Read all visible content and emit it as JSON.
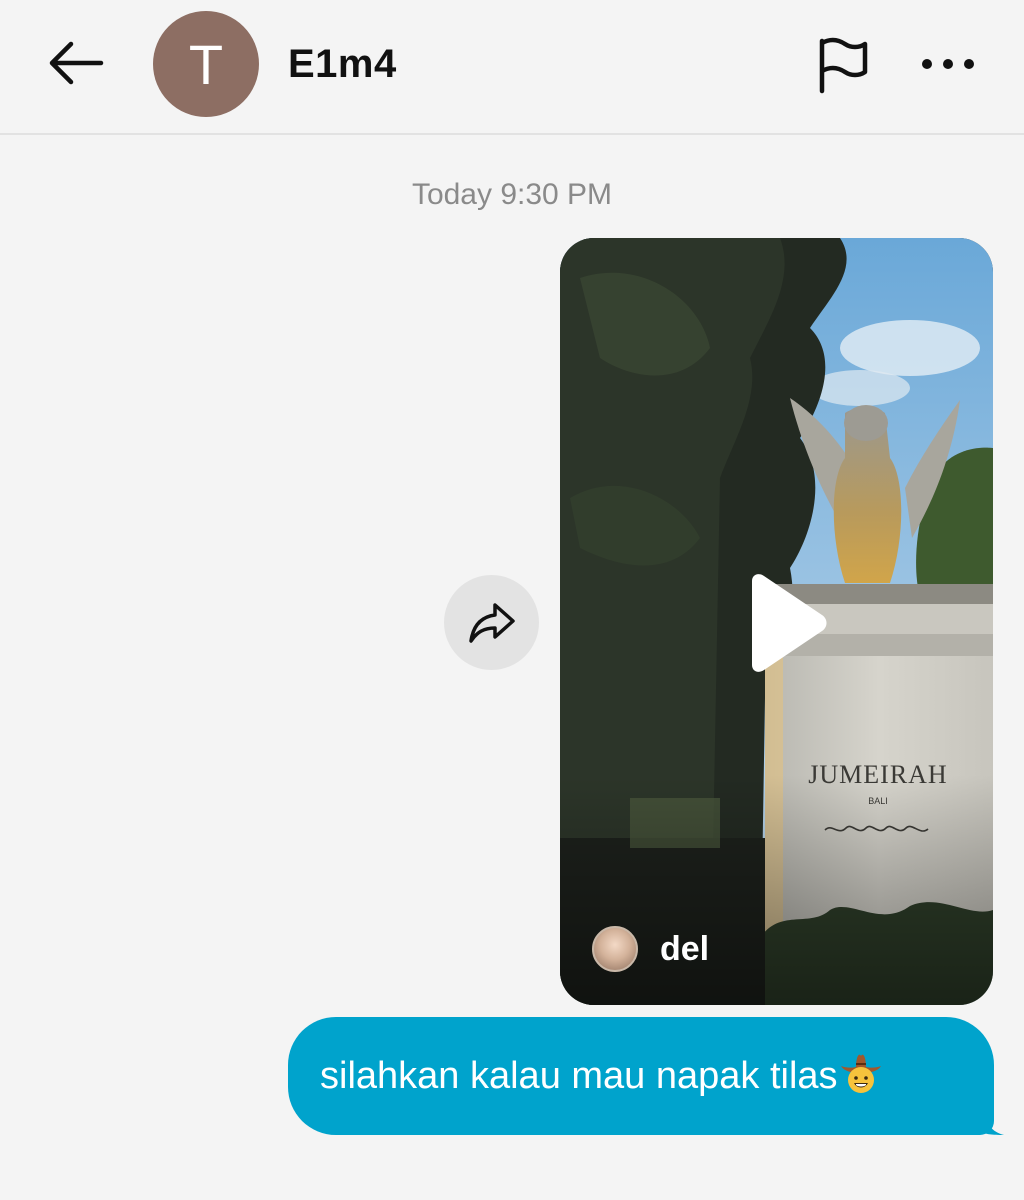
{
  "header": {
    "back_icon": "arrow-left-icon",
    "avatar_initial": "T",
    "avatar_color": "#8d6e63",
    "contact_name": "E1m4",
    "report_icon": "flag-icon",
    "more_icon": "more-horizontal-icon"
  },
  "conversation": {
    "timestamp": "Today 9:30 PM",
    "forward_icon": "share-arrow-icon",
    "shared_video": {
      "author": "del",
      "sign_brand": "JUMEIRAH",
      "sign_location": "BALI",
      "play_icon": "play-icon"
    },
    "message": {
      "text": "silahkan kalau mau napak tilas",
      "emoji": "cowboy-face-emoji",
      "bubble_color": "#00a3cc"
    }
  }
}
